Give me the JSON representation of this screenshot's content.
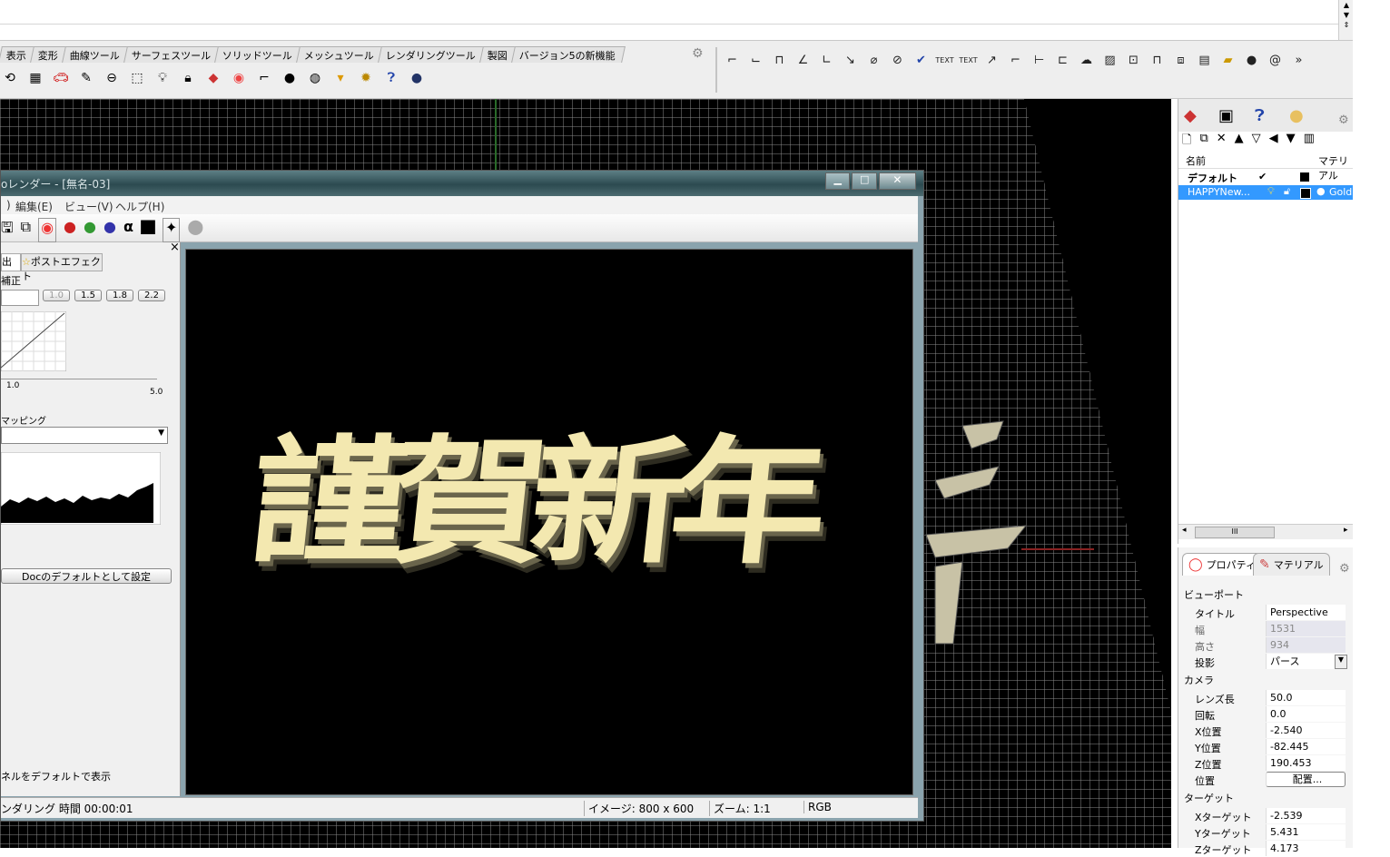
{
  "toolbar": {
    "tabs": [
      "表示",
      "変形",
      "曲線ツール",
      "サーフェスツール",
      "ソリッドツール",
      "メッシュツール",
      "レンダリングツール",
      "製図",
      "バージョン5の新機能"
    ]
  },
  "right_toolbar": {
    "text1": "TEXT",
    "text2": "TEXT",
    "more": "»"
  },
  "render_window": {
    "title": "oレンダー - [無名-03]",
    "menu": [
      "編集(E)",
      "ビュー(V)",
      "ヘルプ(H)"
    ],
    "close_x": "×",
    "tabs": [
      "出",
      "ポストエフェクト"
    ],
    "gamma_label": "補正",
    "gamma_buttons": [
      "1.0",
      "1.5",
      "1.8",
      "2.2"
    ],
    "slider_min": "1.0",
    "slider_max": "5.0",
    "tonemap_label": "マッピング",
    "doc_default_button": "Docのデフォルトとして設定",
    "bottom_note": "ネルをデフォルトで表示",
    "status_time": "ンダリング 時間 00:00:01",
    "status_image": "イメージ: 800 x 600",
    "status_zoom": "ズーム: 1:1",
    "status_mode": "RGB",
    "image_text": "謹賀新年"
  },
  "layers": {
    "header_name": "名前",
    "header_material": "マテリアル",
    "rows": [
      {
        "name": "デフォルト",
        "check": "✔",
        "material": ""
      },
      {
        "name": "HAPPYNew...",
        "check": "",
        "material": "Gold"
      }
    ],
    "scroll_grip": "III"
  },
  "properties": {
    "tabs": [
      "プロパティ",
      "マテリアル"
    ],
    "viewport_group": "ビューポート",
    "camera_group": "カメラ",
    "target_group": "ターゲット",
    "rows": [
      {
        "key": "タイトル",
        "value": "Perspective"
      },
      {
        "key": "幅",
        "value": "1531"
      },
      {
        "key": "高さ",
        "value": "934"
      },
      {
        "key": "投影",
        "value": "パース"
      }
    ],
    "camera_rows": [
      {
        "key": "レンズ長",
        "value": "50.0"
      },
      {
        "key": "回転",
        "value": "0.0"
      },
      {
        "key": "X位置",
        "value": "-2.540"
      },
      {
        "key": "Y位置",
        "value": "-82.445"
      },
      {
        "key": "Z位置",
        "value": "190.453"
      },
      {
        "key": "位置",
        "value": "配置..."
      }
    ],
    "target_rows": [
      {
        "key": "Xターゲット",
        "value": "-2.539"
      },
      {
        "key": "Yターゲット",
        "value": "5.431"
      },
      {
        "key": "Zターゲット",
        "value": "4.173"
      }
    ]
  }
}
